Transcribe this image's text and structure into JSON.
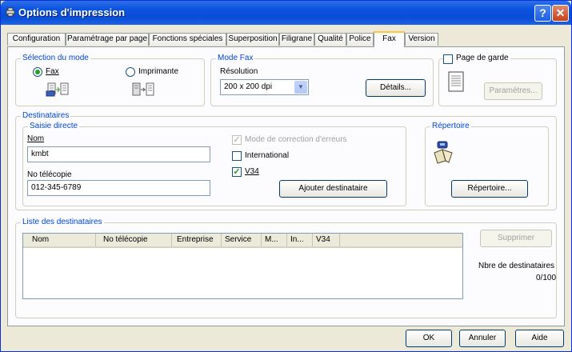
{
  "window": {
    "title": "Options d'impression"
  },
  "tabs": [
    {
      "label": "Configuration"
    },
    {
      "label": "Paramétrage par page"
    },
    {
      "label": "Fonctions spéciales"
    },
    {
      "label": "Superposition"
    },
    {
      "label": "Filigrane"
    },
    {
      "label": "Qualité"
    },
    {
      "label": "Police"
    },
    {
      "label": "Fax",
      "active": true
    },
    {
      "label": "Version"
    }
  ],
  "mode": {
    "group_label": "Sélection du mode",
    "fax_label": "Fax",
    "printer_label": "Imprimante",
    "selected": "Fax"
  },
  "fax_mode": {
    "group_label": "Mode Fax",
    "resolution_label": "Résolution",
    "resolution_value": "200 x 200 dpi",
    "details_button": "Détails..."
  },
  "cover": {
    "checkbox_label": "Page de garde",
    "checked": false,
    "params_button": "Paramètres..."
  },
  "recipients": {
    "group_label": "Destinataires",
    "direct_label": "Saisie directe",
    "name_label": "Nom",
    "name_value": "kmbt",
    "fax_label": "No télécopie",
    "fax_value": "012-345-6789",
    "ecm_label": "Mode de correction d'erreurs",
    "intl_label": "International",
    "v34_label": "V34",
    "v34_checked": true,
    "add_button": "Ajouter destinataire"
  },
  "directory": {
    "group_label": "Répertoire",
    "button": "Répertoire..."
  },
  "list": {
    "group_label": "Liste des destinataires",
    "columns": [
      "Nom",
      "No télécopie",
      "Entreprise",
      "Service",
      "M...",
      "In...",
      "V34"
    ],
    "delete_button": "Supprimer",
    "count_label": "Nbre de destinataires",
    "count_value": "0/100"
  },
  "footer": {
    "ok": "OK",
    "cancel": "Annuler",
    "help": "Aide"
  }
}
